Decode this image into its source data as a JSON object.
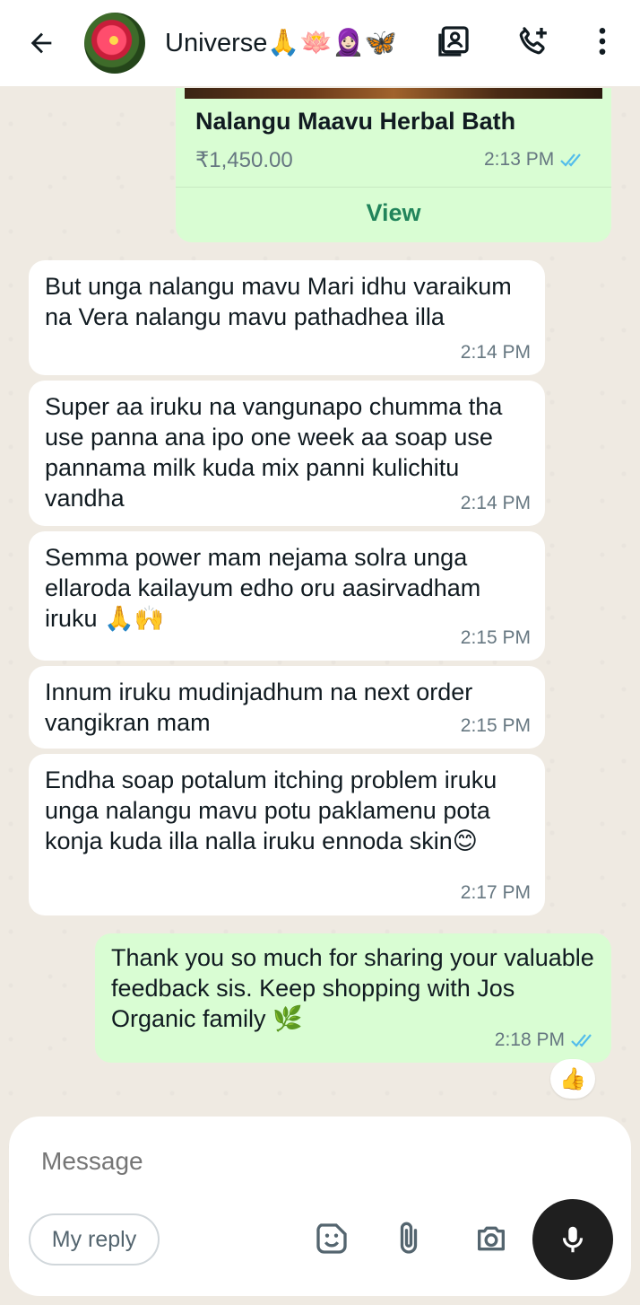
{
  "header": {
    "title": "Universe🙏🪷🧕🏻🦋",
    "icons": [
      "back-arrow-icon",
      "contact-card-icon",
      "add-call-icon",
      "more-vert-icon"
    ]
  },
  "product": {
    "title": "Nalangu Maavu Herbal Bath",
    "price": "₹1,450.00",
    "time": "2:13 PM",
    "view_label": "View"
  },
  "messages": [
    {
      "direction": "in",
      "text": "But unga nalangu mavu Mari idhu varaikum na Vera nalangu mavu pathadhea illa",
      "time": "2:14 PM"
    },
    {
      "direction": "in",
      "text": "Super aa iruku na vangunapo chumma tha use panna ana ipo one week aa soap use pannama milk kuda mix panni kulichitu vandha",
      "time": "2:14 PM"
    },
    {
      "direction": "in",
      "text": "Semma power mam nejama solra unga ellaroda kailayum edho oru aasirvadham iruku 🙏🙌",
      "time": "2:15 PM"
    },
    {
      "direction": "in",
      "text": "Innum iruku mudinjadhum na next order vangikran mam",
      "time": "2:15 PM"
    },
    {
      "direction": "in",
      "text": "Endha soap potalum itching problem iruku unga nalangu mavu potu paklamenu pota konja kuda illa nalla iruku ennoda skin😊",
      "time": "2:17 PM"
    },
    {
      "direction": "out",
      "text": "Thank you so much for sharing your valuable feedback sis. Keep shopping with Jos Organic family 🌿",
      "time": "2:18 PM"
    }
  ],
  "reaction": "👍",
  "composer": {
    "placeholder": "Message",
    "my_reply_label": "My reply",
    "icons": [
      "sticker-icon",
      "attach-icon",
      "camera-icon",
      "mic-icon"
    ]
  },
  "colors": {
    "incoming_bubble": "#ffffff",
    "outgoing_bubble": "#d9fdd3",
    "read_tick": "#53bdeb",
    "accent_green": "#21845b"
  }
}
